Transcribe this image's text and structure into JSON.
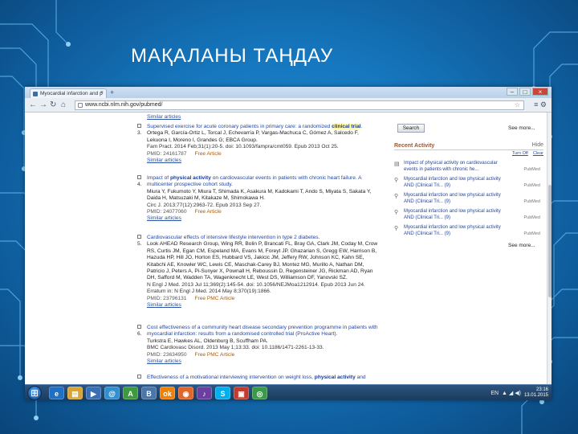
{
  "slide": {
    "title": "МАҚАЛАНЫ ТАҢДАУ"
  },
  "browser": {
    "tab_title": "Myocardial infarction and p",
    "tab_close": "×",
    "new_tab": "+",
    "url": "www.ncbi.nlm.nih.gov/pubmed/",
    "window_buttons": [
      "–",
      "□",
      "×"
    ]
  },
  "results": {
    "similar_top": "Similar articles",
    "items": [
      {
        "number": "3.",
        "title_pre": "Supervised exercise for acute coronary patients in primary care: a randomized ",
        "title_bold": "clinical trial",
        "title_post": ".",
        "authors": "Ortega R, García-Ortiz L, Torcal J, Echevarría P, Vargas-Machuca C, Gómez A, Salcedo F, Lekuona I, Moreno I, Grandes G; EBCA Group.",
        "journal": "Fam Pract. 2014 Feb;31(1):20-5. doi: 10.1093/fampra/cmt059. Epub 2013 Oct 25.",
        "meta": "PMID: 24161787",
        "free": "Free Article",
        "similar": "Similar articles"
      },
      {
        "number": "4.",
        "title_pre": "Impact of ",
        "title_bold": "physical activity",
        "title_post": " on cardiovascular events in patients with chronic heart failure. A multicenter prospective cohort study.",
        "authors": "Miura Y, Fukumoto Y, Miura T, Shimada K, Asakura M, Kadokami T, Ando S, Miyata S, Sakata Y, Daida H, Matsuzaki M, Kitakaze M, Shimokawa H.",
        "journal": "Circ J. 2013;77(12):2963-72. Epub 2013 Sep 27.",
        "meta": "PMID: 24077060",
        "free": "Free Article",
        "similar": "Similar articles"
      },
      {
        "number": "5.",
        "title_pre": "Cardiovascular effects of intensive lifestyle intervention in type 2 diabetes.",
        "title_bold": "",
        "title_post": "",
        "authors": "Look AHEAD Research Group, Wing RR, Bolin P, Brancati FL, Bray GA, Clark JM, Coday M, Crow RS, Curtis JM, Egan CM, Espeland MA, Evans M, Foreyt JP, Ghazarian S, Gregg EW, Harrison B, Hazuda HP, Hill JO, Horton ES, Hubbard VS, Jakicic JM, Jeffery RW, Johnson KC, Kahn SE, Kitabchi AE, Knowler WC, Lewis CE, Maschak-Carey BJ, Montez MG, Murillo A, Nathan DM, Patricio J, Peters A, Pi-Sunyer X, Pownall H, Reboussin D, Regensteiner JG, Rickman AD, Ryan DH, Safford M, Wadden TA, Wagenknecht LE, West DS, Williamson DF, Yanovski SZ.",
        "journal": "N Engl J Med. 2013 Jul 11;369(2):145-54. doi: 10.1056/NEJMoa1212914. Epub 2013 Jun 24. Erratum in: N Engl J Med. 2014 May 8;370(19):1866.",
        "meta": "PMID: 23796131",
        "free": "Free PMC Article",
        "similar": "Similar articles"
      },
      {
        "number": "6.",
        "title_pre": "Cost effectiveness of a community ",
        "title_bold": "",
        "title_post": "heart disease secondary prevention programme in patients with myocardial infarction: results from a randomised controlled trial (ProActive Heart).",
        "authors": "Turkstra E, Hawkes AL, Oldenburg B, Scuffham PA.",
        "journal": "BMC Cardiovasc Disord. 2013 May 1;13:33. doi: 10.1186/1471-2261-13-33.",
        "meta": "PMID: 23634950",
        "free": "Free PMC Article",
        "similar": "Similar articles"
      },
      {
        "number": "7.",
        "title_pre": "Effectiveness of a motivational interviewing intervention on weight loss, ",
        "title_bold": "physical activity",
        "title_post": " and",
        "authors": "",
        "journal": "",
        "meta": "",
        "free": "",
        "similar": ""
      }
    ]
  },
  "sidebar": {
    "search_button": "Search",
    "see_more_1": "See more...",
    "see_more_2": "See more...",
    "recent_activity_title": "Recent Activity",
    "recent_activity_toggle": "Hide",
    "actions": [
      "Turn Off",
      "Clear"
    ],
    "items": [
      {
        "icon": "doc",
        "text": "Impact of physical activity on cardiovascular events in patients with chronic he...",
        "source": "PubMed"
      },
      {
        "icon": "search",
        "text": "Myocardial infarction and low physical activity AND (Clinical Tri... (9)",
        "source": "PubMed"
      },
      {
        "icon": "search",
        "text": "Myocardial infarction and low physical activity AND (Clinical Tri... (9)",
        "source": "PubMed"
      },
      {
        "icon": "search",
        "text": "Myocardial infarction and low physical activity AND (Clinical Tri... (9)",
        "source": "PubMed"
      },
      {
        "icon": "search",
        "text": "Myocardial infarction and low physical activity AND (Clinical Tri... (9)",
        "source": "PubMed"
      }
    ]
  },
  "taskbar": {
    "apps": [
      {
        "name": "ie",
        "glyph": "e",
        "color": "#1f6fc4"
      },
      {
        "name": "explorer",
        "glyph": "▤",
        "color": "#d6a437"
      },
      {
        "name": "media",
        "glyph": "▶",
        "color": "#3b6fb5"
      },
      {
        "name": "mail",
        "glyph": "@",
        "color": "#2f8fcf"
      },
      {
        "name": "app-a",
        "glyph": "A",
        "color": "#3e9a3e"
      },
      {
        "name": "vk",
        "glyph": "B",
        "color": "#4a76a8"
      },
      {
        "name": "ok",
        "glyph": "ok",
        "color": "#ee8208"
      },
      {
        "name": "firefox",
        "glyph": "◉",
        "color": "#e0662c"
      },
      {
        "name": "music",
        "glyph": "♪",
        "color": "#6a3fa0"
      },
      {
        "name": "skype",
        "glyph": "S",
        "color": "#00aff0"
      },
      {
        "name": "pdf",
        "glyph": "▣",
        "color": "#c23b2e"
      },
      {
        "name": "chrome",
        "glyph": "◎",
        "color": "#3a9a4a"
      }
    ],
    "tray_lang": "EN",
    "time": "23:16",
    "date": "13.01.2015"
  },
  "colors": {
    "background": "#1678bf",
    "link": "#2547a3",
    "recent_activity": "#985735"
  }
}
